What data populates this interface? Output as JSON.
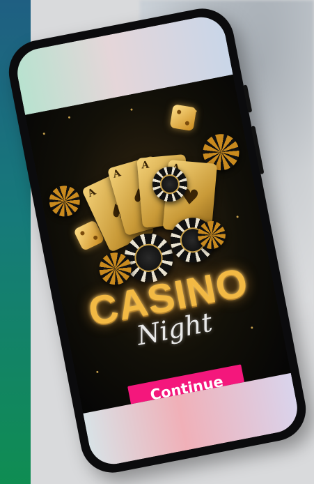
{
  "banner": {
    "title_main": "CASINO",
    "title_sub": "Night",
    "cta_label": "Continue"
  },
  "cards": [
    {
      "rank": "A",
      "suit": "♠"
    },
    {
      "rank": "A",
      "suit": "♠"
    },
    {
      "rank": "A",
      "suit": "♥"
    },
    {
      "rank": "A",
      "suit": "♥"
    }
  ],
  "colors": {
    "cta_background": "#f4177c",
    "title_gold": "#f2b944",
    "left_band_top": "#1f5f82",
    "left_band_bottom": "#0f8d52"
  },
  "icons": [
    "dice-icon",
    "playing-card-icon",
    "poker-chip-icon"
  ]
}
